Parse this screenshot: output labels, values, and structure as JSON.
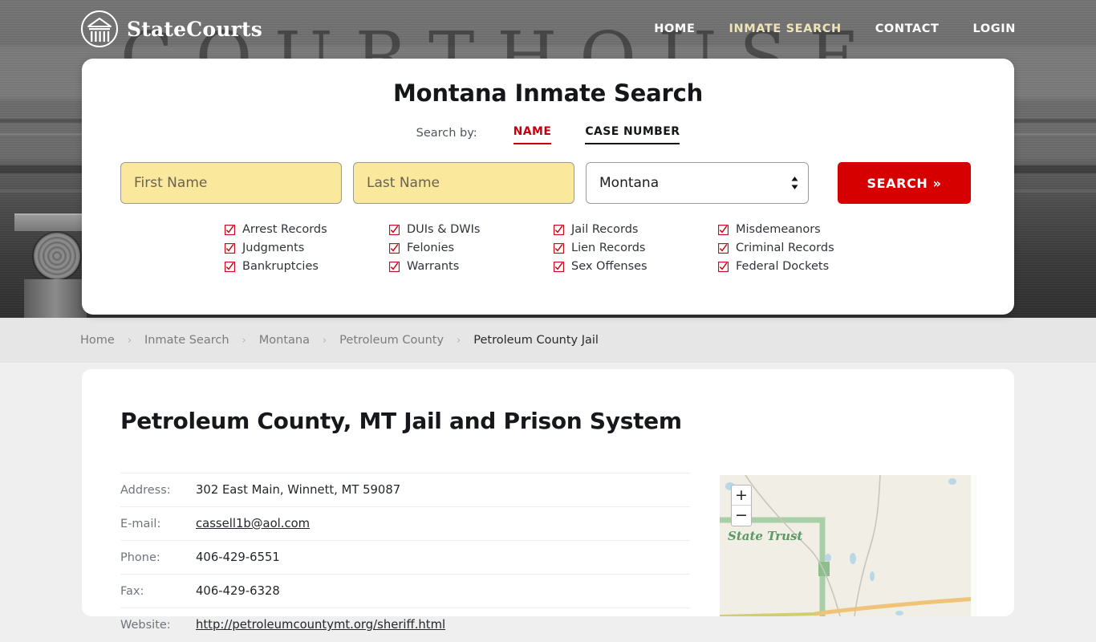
{
  "site": {
    "brand": "StateCourts",
    "logo_icon": "courthouse-logo-icon",
    "nav": [
      {
        "label": "HOME",
        "active": false
      },
      {
        "label": "INMATE SEARCH",
        "active": true
      },
      {
        "label": "CONTACT",
        "active": false
      },
      {
        "label": "LOGIN",
        "active": false
      }
    ],
    "hero_word": "COURTHOUSE"
  },
  "search": {
    "title": "Montana Inmate Search",
    "search_by_label": "Search by:",
    "tabs": [
      {
        "label": "NAME",
        "active": true,
        "color": "#c4000f"
      },
      {
        "label": "CASE NUMBER",
        "active": false,
        "color": "#14161a"
      }
    ],
    "first_name": {
      "value": "",
      "placeholder": "First Name"
    },
    "last_name": {
      "value": "",
      "placeholder": "Last Name"
    },
    "state": {
      "selected": "Montana",
      "options": [
        "Montana"
      ]
    },
    "button_label": "SEARCH",
    "button_chevron": "»",
    "button_color": "#d60000",
    "field_color": "#fae89d",
    "checkbox_glyph": "☑",
    "record_types": [
      "Arrest Records",
      "DUIs & DWIs",
      "Jail Records",
      "Misdemeanors",
      "Judgments",
      "Felonies",
      "Lien Records",
      "Criminal Records",
      "Bankruptcies",
      "Warrants",
      "Sex Offenses",
      "Federal Dockets"
    ]
  },
  "breadcrumb": {
    "separator": "›",
    "items": [
      {
        "label": "Home",
        "current": false
      },
      {
        "label": "Inmate Search",
        "current": false
      },
      {
        "label": "Montana",
        "current": false
      },
      {
        "label": "Petroleum County",
        "current": false
      },
      {
        "label": "Petroleum County Jail",
        "current": true
      }
    ]
  },
  "page": {
    "title": "Petroleum County, MT Jail and Prison System",
    "details": [
      {
        "label": "Address:",
        "value": "302 East Main, Winnett, MT 59087",
        "link": false
      },
      {
        "label": "E-mail:",
        "value": "cassell1b@aol.com",
        "link": true
      },
      {
        "label": "Phone:",
        "value": "406-429-6551",
        "link": false
      },
      {
        "label": "Fax:",
        "value": "406-429-6328",
        "link": false
      },
      {
        "label": "Website:",
        "value": "http://petroleumcountymt.org/sheriff.html",
        "link": true
      }
    ]
  },
  "map": {
    "label": "State Trust",
    "zoom_in": "+",
    "zoom_out": "−",
    "land_color": "#f1eee5",
    "boundary_color": "#a9cfa6",
    "road_color": "#f0c478",
    "water_color": "#b8d8e8"
  }
}
